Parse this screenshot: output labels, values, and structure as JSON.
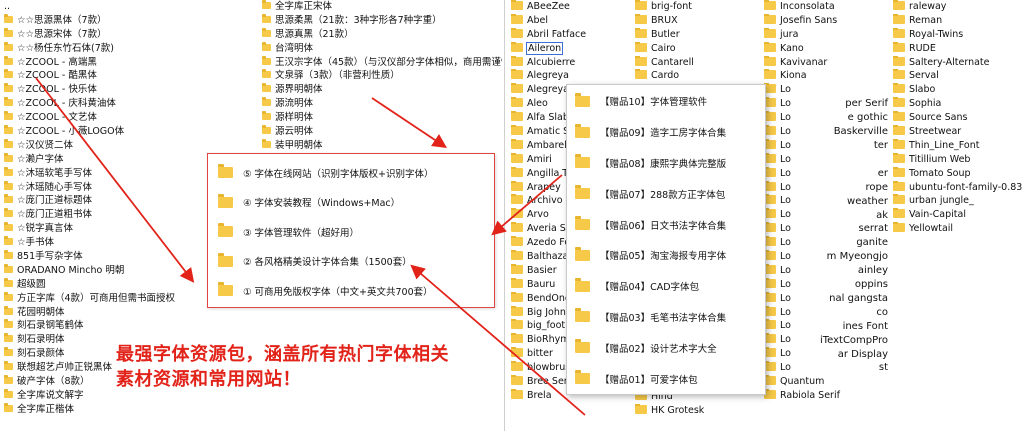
{
  "left_col1": [
    {
      "t": "..",
      "up": true
    },
    {
      "t": "☆☆思源黑体（7款）"
    },
    {
      "t": "☆☆思源宋体（7款）"
    },
    {
      "t": "☆☆杨任东竹石体(7款)"
    },
    {
      "t": "☆ZCOOL - 高端黑"
    },
    {
      "t": "☆ZCOOL - 酷黑体"
    },
    {
      "t": "☆ZCOOL - 快乐体"
    },
    {
      "t": "☆ZCOOL - 庆科黄油体"
    },
    {
      "t": "☆ZCOOL - 文艺体"
    },
    {
      "t": "☆ZCOOL - 小薇LOGO体"
    },
    {
      "t": "☆汉仪贤二体"
    },
    {
      "t": "☆濑户字体"
    },
    {
      "t": "☆沐瑶软笔手写体"
    },
    {
      "t": "☆沐瑶随心手写体"
    },
    {
      "t": "☆庞门正道标题体"
    },
    {
      "t": "☆庞门正道粗书体"
    },
    {
      "t": "☆锐字真言体"
    },
    {
      "t": "☆手书体"
    },
    {
      "t": "851手写杂字体"
    },
    {
      "t": "ORADANO Mincho 明朝"
    },
    {
      "t": "超级圆"
    },
    {
      "t": "方正字库（4款）可商用但需书面授权"
    },
    {
      "t": "花园明朝体"
    },
    {
      "t": "刻石录钢笔鹤体"
    },
    {
      "t": "刻石录明体"
    },
    {
      "t": "刻石录颜体"
    },
    {
      "t": "联想超艺卢帅正锐黑体"
    },
    {
      "t": "破产字体（8款）"
    },
    {
      "t": "全字库说文解字"
    },
    {
      "t": "全字库正楷体"
    }
  ],
  "left_col2": [
    {
      "t": "全字库正宋体"
    },
    {
      "t": "思源柔黑（21款：3种字形各7种字重）"
    },
    {
      "t": "思源真黑（21款）"
    },
    {
      "t": "台湾明体"
    },
    {
      "t": "王汉宗字体（45款）（与汉仪部分字体相似，商用需谨慎）"
    },
    {
      "t": "文泉驿（3款）（非营利性质）"
    },
    {
      "t": "源界明朝体"
    },
    {
      "t": "源流明体"
    },
    {
      "t": "源样明体"
    },
    {
      "t": "源云明体"
    },
    {
      "t": "装甲明朝体"
    }
  ],
  "right_col1": [
    {
      "t": "ABeeZee"
    },
    {
      "t": "Abel"
    },
    {
      "t": "Abril Fatface"
    },
    {
      "t": "Aileron",
      "selected": true
    },
    {
      "t": "Alcubierre"
    },
    {
      "t": "Alegreya"
    },
    {
      "t": "Alegreya Sa"
    },
    {
      "t": "Aleo"
    },
    {
      "t": "Alfa Slab O"
    },
    {
      "t": "Amatic SC"
    },
    {
      "t": "Ambarella"
    },
    {
      "t": "Amiri"
    },
    {
      "t": "Angilla Tat"
    },
    {
      "t": "Arapey"
    },
    {
      "t": "Archivo Bl"
    },
    {
      "t": "Arvo"
    },
    {
      "t": "Averia Ser"
    },
    {
      "t": "Azedo Fo"
    },
    {
      "t": "Balthazar"
    },
    {
      "t": "Basier"
    },
    {
      "t": "Bauru"
    },
    {
      "t": "BendOne"
    },
    {
      "t": "Big John"
    },
    {
      "t": "big_foot"
    },
    {
      "t": "BioRhyme"
    },
    {
      "t": "bitter"
    },
    {
      "t": "blowbrush"
    },
    {
      "t": "Bree Serif"
    },
    {
      "t": "Brela"
    }
  ],
  "right_col2": [
    {
      "t": "brig-font"
    },
    {
      "t": "BRUX"
    },
    {
      "t": "Butler"
    },
    {
      "t": "Cairo"
    },
    {
      "t": "Cantarell"
    },
    {
      "t": "Cardo"
    }
  ],
  "right_col2_bottom": [
    {
      "t": "Hind"
    },
    {
      "t": "HK Grotesk"
    }
  ],
  "right_col3": [
    {
      "t": "Inconsolata"
    },
    {
      "t": "Josefin Sans"
    },
    {
      "t": "jura"
    },
    {
      "t": "Kano"
    },
    {
      "t": "Kavivanar"
    },
    {
      "t": "Kiona"
    },
    {
      "t": "Lo"
    },
    {
      "t": "Lo"
    },
    {
      "t": "Lo"
    },
    {
      "t": "Lo"
    },
    {
      "t": "Lo"
    },
    {
      "t": "Lo"
    },
    {
      "t": "Lo"
    },
    {
      "t": "Lo"
    },
    {
      "t": "Lo"
    },
    {
      "t": "Lo"
    },
    {
      "t": "Lo"
    },
    {
      "t": "Lo"
    },
    {
      "t": "Lo"
    },
    {
      "t": "Lo"
    },
    {
      "t": "Lo"
    },
    {
      "t": "Lo"
    },
    {
      "t": "Lo"
    },
    {
      "t": "Lo"
    },
    {
      "t": "Lo"
    },
    {
      "t": "Lo"
    },
    {
      "t": "Lo"
    },
    {
      "t": "Quantum"
    },
    {
      "t": "Rabiola Serif"
    }
  ],
  "right_col3_tails": [
    {
      "row": 7,
      "t": "per Serif"
    },
    {
      "row": 8,
      "t": "e gothic"
    },
    {
      "row": 9,
      "t": "Baskerville"
    },
    {
      "row": 10,
      "t": "ter"
    },
    {
      "row": 12,
      "t": "er"
    },
    {
      "row": 13,
      "t": "rope"
    },
    {
      "row": 14,
      "t": "weather"
    },
    {
      "row": 15,
      "t": "ak"
    },
    {
      "row": 16,
      "t": "serrat"
    },
    {
      "row": 17,
      "t": "ganite"
    },
    {
      "row": 18,
      "t": "m Myeongjo"
    },
    {
      "row": 19,
      "t": "ainley"
    },
    {
      "row": 20,
      "t": "oppins"
    },
    {
      "row": 21,
      "t": "nal gangsta"
    },
    {
      "row": 22,
      "t": "co"
    },
    {
      "row": 23,
      "t": "ines Font"
    },
    {
      "row": 24,
      "t": "iTextCompPro"
    },
    {
      "row": 25,
      "t": "ar Display"
    },
    {
      "row": 26,
      "t": "st"
    }
  ],
  "right_col4": [
    {
      "t": "raleway"
    },
    {
      "t": "Reman"
    },
    {
      "t": "Royal-Twins"
    },
    {
      "t": "RUDE"
    },
    {
      "t": "Saltery-Alternate"
    },
    {
      "t": "Serval"
    },
    {
      "t": "Slabo"
    },
    {
      "t": "Sophia"
    },
    {
      "t": "Source Sans"
    },
    {
      "t": "Streetwear"
    },
    {
      "t": "Thin_Line_Font"
    },
    {
      "t": "Titillium Web"
    },
    {
      "t": "Tomato Soup"
    },
    {
      "t": "ubuntu-font-family-0.83"
    },
    {
      "t": "urban jungle_"
    },
    {
      "t": "Vain-Capital"
    },
    {
      "t": "Yellowtail"
    }
  ],
  "popup_center": [
    {
      "t": "⑤ 字体在线网站（识别字体版权+识别字体）"
    },
    {
      "t": "④ 字体安装教程（Windows+Mac）"
    },
    {
      "t": "③ 字体管理软件（超好用）"
    },
    {
      "t": "② 各风格精美设计字体合集（1500套）"
    },
    {
      "t": "① 可商用免版权字体（中文+英文共700套）"
    }
  ],
  "popup_right": [
    {
      "t": "【赠品10】字体管理软件"
    },
    {
      "t": "【赠品09】造字工房字体合集"
    },
    {
      "t": "【赠品08】康熙字典体完整版"
    },
    {
      "t": "【赠品07】288款方正字体包"
    },
    {
      "t": "【赠品06】日文书法字体合集"
    },
    {
      "t": "【赠品05】淘宝海报专用字体"
    },
    {
      "t": "【赠品04】CAD字体包"
    },
    {
      "t": "【赠品03】毛笔书法字体合集"
    },
    {
      "t": "【赠品02】设计艺术字大全"
    },
    {
      "t": "【赠品01】可爱字体包"
    }
  ],
  "caption": {
    "line1": "最强字体资源包，涵盖所有热门字体相关",
    "line2": "素材资源和常用网站！",
    "color": "#e2231a"
  },
  "colors": {
    "folder": "#f6c948",
    "popup_border": "#e24444",
    "arrow": "#e2231a",
    "selection": "#3b6fd6"
  }
}
